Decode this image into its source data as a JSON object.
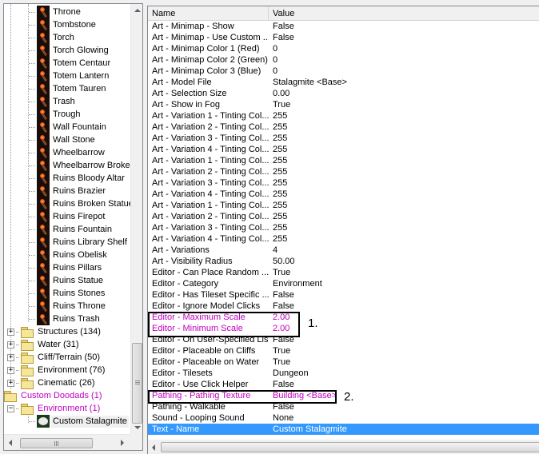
{
  "tree": {
    "doodad_items": [
      "Throne",
      "Tombstone",
      "Torch",
      "Torch Glowing",
      "Totem Centaur",
      "Totem Lantern",
      "Totem Tauren",
      "Trash",
      "Trough",
      "Wall Fountain",
      "Wall Stone",
      "Wheelbarrow",
      "Wheelbarrow Broken",
      "Ruins Bloody Altar",
      "Ruins Brazier",
      "Ruins Broken Statue",
      "Ruins Firepot",
      "Ruins Fountain",
      "Ruins Library Shelf",
      "Ruins Obelisk",
      "Ruins Pillars",
      "Ruins Statue",
      "Ruins Stones",
      "Ruins Throne",
      "Ruins Trash"
    ],
    "folders": [
      {
        "label": "Structures (134)",
        "expander": "+"
      },
      {
        "label": "Water (31)",
        "expander": "+"
      },
      {
        "label": "Cliff/Terrain (50)",
        "expander": "+"
      },
      {
        "label": "Environment (76)",
        "expander": "+"
      },
      {
        "label": "Cinematic (26)",
        "expander": "+"
      }
    ],
    "custom_root": {
      "label": "Custom Doodads (1)"
    },
    "custom_folder": {
      "label": "Environment (1)",
      "expander": "−"
    },
    "custom_item": {
      "label": "Custom Stalagmite",
      "selected": true
    },
    "scrollbar_grip": "≡",
    "hscroll_grip": "III"
  },
  "grid": {
    "headers": {
      "name": "Name",
      "value": "Value"
    },
    "rows": [
      {
        "name": "Art - Minimap - Show",
        "value": "False"
      },
      {
        "name": "Art - Minimap - Use Custom ...",
        "value": "False"
      },
      {
        "name": "Art - Minimap Color 1 (Red)",
        "value": "0"
      },
      {
        "name": "Art - Minimap Color 2 (Green)",
        "value": "0"
      },
      {
        "name": "Art - Minimap Color 3 (Blue)",
        "value": "0"
      },
      {
        "name": "Art - Model File",
        "value": "Stalagmite <Base>"
      },
      {
        "name": "Art - Selection Size",
        "value": "0.00"
      },
      {
        "name": "Art - Show in Fog",
        "value": "True"
      },
      {
        "name": "Art - Variation 1 - Tinting Col...",
        "value": "255"
      },
      {
        "name": "Art - Variation 2 - Tinting Col...",
        "value": "255"
      },
      {
        "name": "Art - Variation 3 - Tinting Col...",
        "value": "255"
      },
      {
        "name": "Art - Variation 4 - Tinting Col...",
        "value": "255"
      },
      {
        "name": "Art - Variation 1 - Tinting Col...",
        "value": "255"
      },
      {
        "name": "Art - Variation 2 - Tinting Col...",
        "value": "255"
      },
      {
        "name": "Art - Variation 3 - Tinting Col...",
        "value": "255"
      },
      {
        "name": "Art - Variation 4 - Tinting Col...",
        "value": "255"
      },
      {
        "name": "Art - Variation 1 - Tinting Col...",
        "value": "255"
      },
      {
        "name": "Art - Variation 2 - Tinting Col...",
        "value": "255"
      },
      {
        "name": "Art - Variation 3 - Tinting Col...",
        "value": "255"
      },
      {
        "name": "Art - Variation 4 - Tinting Col...",
        "value": "255"
      },
      {
        "name": "Art - Variations",
        "value": "4"
      },
      {
        "name": "Art - Visibility Radius",
        "value": "50.00"
      },
      {
        "name": "Editor - Can Place Random ...",
        "value": "True"
      },
      {
        "name": "Editor - Category",
        "value": "Environment"
      },
      {
        "name": "Editor - Has Tileset Specific ...",
        "value": "False"
      },
      {
        "name": "Editor - Ignore Model Clicks",
        "value": "False"
      },
      {
        "name": "Editor - Maximum Scale",
        "value": "2.00",
        "modified": true
      },
      {
        "name": "Editor - Minimum Scale",
        "value": "2.00",
        "modified": true
      },
      {
        "name": "Editor - On User-Specified List",
        "value": "False"
      },
      {
        "name": "Editor - Placeable on Cliffs",
        "value": "True"
      },
      {
        "name": "Editor - Placeable on Water",
        "value": "True"
      },
      {
        "name": "Editor - Tilesets",
        "value": "Dungeon"
      },
      {
        "name": "Editor - Use Click Helper",
        "value": "False"
      },
      {
        "name": "Pathing - Pathing Texture",
        "value": "Building <Base>",
        "modified": true
      },
      {
        "name": "Pathing - Walkable",
        "value": "False"
      },
      {
        "name": "Sound - Looping Sound",
        "value": "None"
      },
      {
        "name": "Text - Name",
        "value": "Custom Stalagmite",
        "selected": true
      }
    ]
  },
  "annotations": [
    {
      "label": "1."
    },
    {
      "label": "2."
    }
  ],
  "colors": {
    "modified_text": "#c000c0",
    "selection": "#3399ff"
  }
}
